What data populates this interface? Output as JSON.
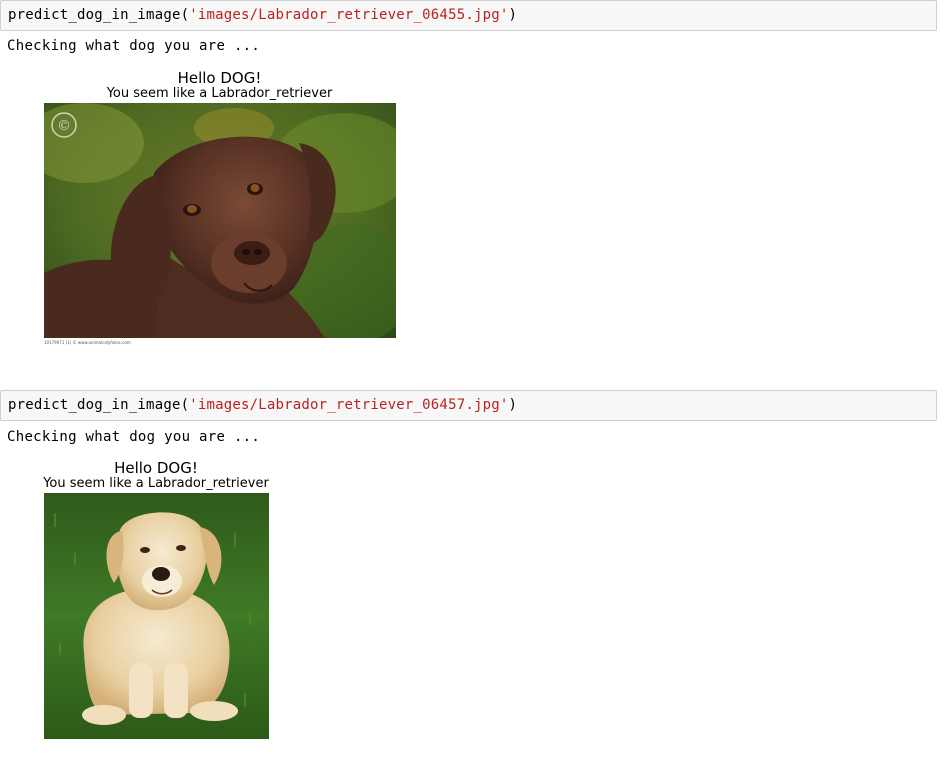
{
  "cells": [
    {
      "code_fn": "predict_dog_in_image(",
      "code_arg": "'images/Labrador_retriever_06455.jpg'",
      "code_close": ")",
      "stdout": "Checking what dog you are ...",
      "figure_title": "Hello DOG!",
      "figure_subtitle": "You seem like a Labrador_retriever",
      "photo": {
        "subject": "chocolate labrador retriever portrait",
        "watermark": "©",
        "caption": "10179071 (1)  © www.animalcalyfolios.com"
      }
    },
    {
      "code_fn": "predict_dog_in_image(",
      "code_arg": "'images/Labrador_retriever_06457.jpg'",
      "code_close": ")",
      "stdout": "Checking what dog you are ...",
      "figure_title": "Hello DOG!",
      "figure_subtitle": "You seem like a Labrador_retriever",
      "photo": {
        "subject": "yellow labrador retriever lying on grass"
      }
    }
  ],
  "colors": {
    "cell_background": "#f7f7f7",
    "cell_border": "#cfcfcf",
    "string_literal": "#ba2121"
  }
}
